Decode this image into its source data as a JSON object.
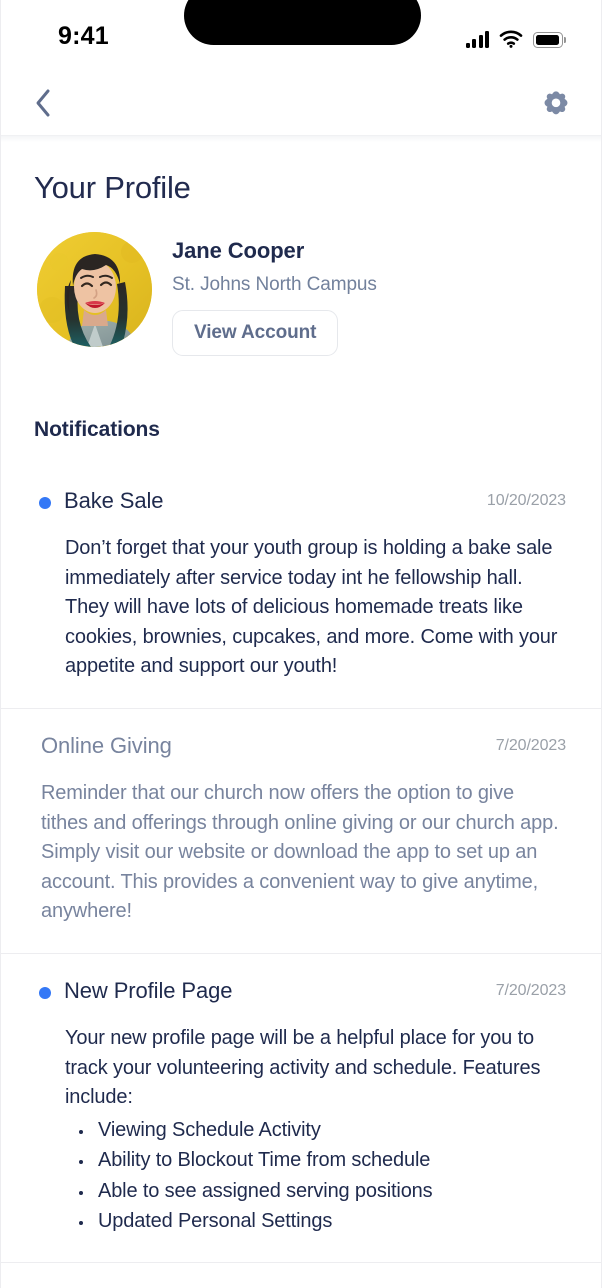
{
  "status_bar": {
    "time": "9:41",
    "cellular_icon": "signal-bars-icon",
    "wifi_icon": "wifi-icon",
    "battery_icon": "battery-icon"
  },
  "nav": {
    "back_icon": "back-chevron-icon",
    "settings_icon": "gear-icon"
  },
  "profile": {
    "page_title": "Your Profile",
    "avatar_alt": "avatar-photo",
    "name": "Jane Cooper",
    "campus": "St. Johns North Campus",
    "view_account_label": "View Account"
  },
  "notifications": {
    "section_title": "Notifications",
    "unread_dot_color": "#3478f6",
    "items": [
      {
        "title": "Bake Sale",
        "date": "10/20/2023",
        "unread": true,
        "body": "Don’t forget that your youth group is holding a bake sale immediately after service today int he fellowship hall. They will have lots of delicious homemade treats like cookies, brownies, cupcakes, and more. Come with your appetite and support our youth!",
        "bullets": []
      },
      {
        "title": "Online Giving",
        "date": "7/20/2023",
        "unread": false,
        "body": "Reminder that our church now offers the option to give tithes and offerings through online giving or our church app. Simply visit our website or download the app to set up an account. This provides a convenient way to give anytime, anywhere!",
        "bullets": []
      },
      {
        "title": "New Profile Page",
        "date": "7/20/2023",
        "unread": true,
        "body": "Your new profile page will be a helpful place for you to track your volunteering activity and schedule. Features include:",
        "bullets": [
          "Viewing Schedule Activity",
          "Ability to Blockout Time from schedule",
          "Able to see assigned serving positions",
          "Updated Personal Settings"
        ]
      }
    ]
  }
}
